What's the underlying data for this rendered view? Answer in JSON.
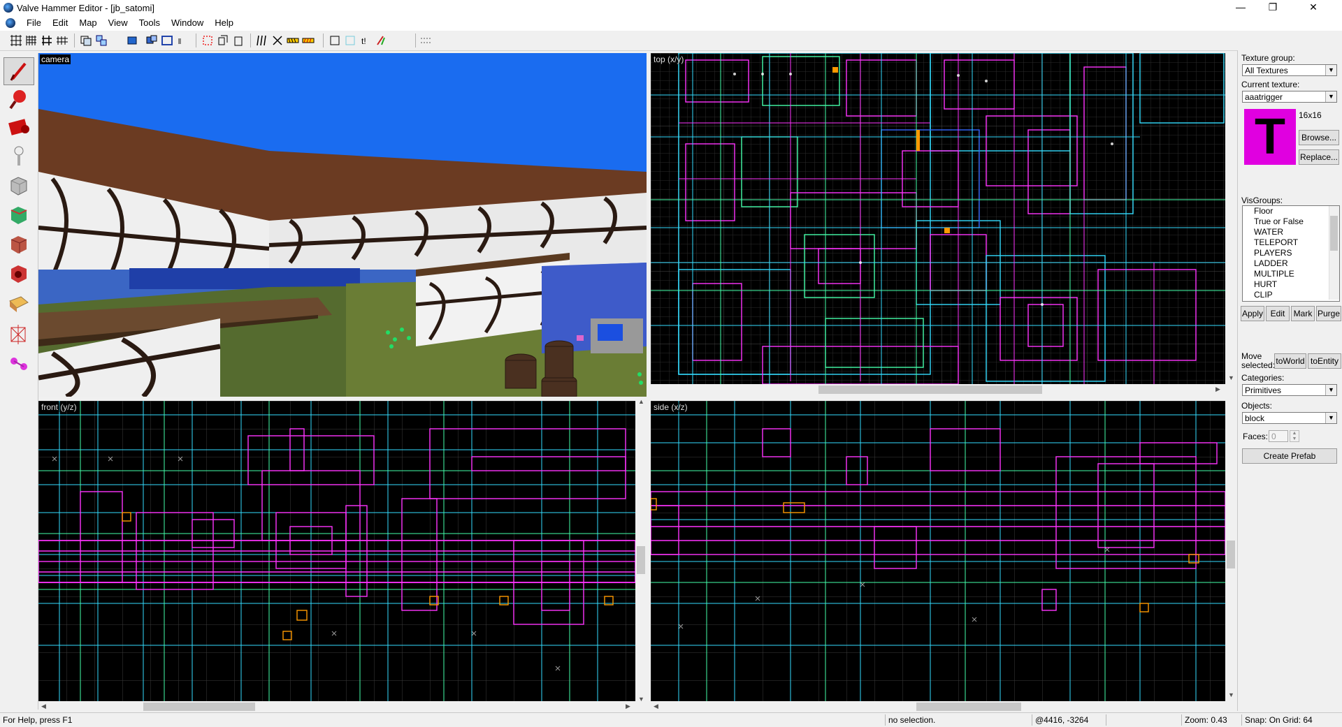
{
  "window": {
    "title": "Valve Hammer Editor - [jb_satomi]",
    "minimize": "—",
    "maximize": "❐",
    "close": "✕"
  },
  "menu": [
    "File",
    "Edit",
    "Map",
    "View",
    "Tools",
    "Window",
    "Help"
  ],
  "mdi_controls": [
    "_",
    "❐",
    "×"
  ],
  "toolbar_icons": [
    "grid-icon",
    "grid-smaller-icon",
    "grid-larger-icon",
    "grid-3d-icon",
    "load-window-state-icon",
    "group-icon",
    "ungroup-icon",
    "hide-icon",
    "carve-icon",
    "hollow-icon",
    "clip-icon",
    "cut-icon",
    "copy-icon",
    "paste-icon",
    "texture-lock-icon",
    "texture-scale-icon",
    "toggle-3d-icon",
    "select-icon",
    "entity-report-icon",
    "run-map-icon",
    "check-problems-icon"
  ],
  "tools": [
    "selection-tool",
    "magnify-tool",
    "camera-tool",
    "entity-tool",
    "block-tool",
    "texture-application-tool",
    "apply-current-texture-tool",
    "decal-tool",
    "overlay-tool",
    "clipping-tool",
    "vertex-tool",
    "path-tool"
  ],
  "viewports": {
    "camera": {
      "label": "camera"
    },
    "top": {
      "label": "top (x/y)"
    },
    "front": {
      "label": "front (y/z)"
    },
    "side": {
      "label": "side (x/z)"
    }
  },
  "panel": {
    "texture_group_label": "Texture group:",
    "texture_group_value": "All Textures",
    "current_texture_label": "Current texture:",
    "current_texture_value": "aaatrigger",
    "texture_letter": "T",
    "texture_size": "16x16",
    "browse": "Browse...",
    "replace": "Replace...",
    "visgroups_label": "VisGroups:",
    "visgroups": [
      "Floor",
      "True or False",
      "WATER",
      "TELEPORT",
      "PLAYERS",
      "LADDER",
      "MULTIPLE",
      "HURT",
      "CLIP"
    ],
    "apply": "Apply",
    "edit": "Edit",
    "mark": "Mark",
    "purge": "Purge",
    "move_selected": "Move selected:",
    "to_world": "toWorld",
    "to_entity": "toEntity",
    "categories_label": "Categories:",
    "categories_value": "Primitives",
    "objects_label": "Objects:",
    "objects_value": "block",
    "faces_label": "Faces:",
    "faces_value": "0",
    "create_prefab": "Create Prefab"
  },
  "status": {
    "help": "For Help, press F1",
    "selection": "no selection.",
    "coords": "@4416, -3264",
    "zoom": "Zoom: 0.43",
    "snap": "Snap: On Grid: 64"
  },
  "colors": {
    "brush_magenta": "#ff33ff",
    "brush_cyan": "#33ddff",
    "brush_green": "#44ffaa",
    "brush_blue": "#3366ff",
    "entity_orange": "#ff9900",
    "sky": "#1a6cf0"
  }
}
